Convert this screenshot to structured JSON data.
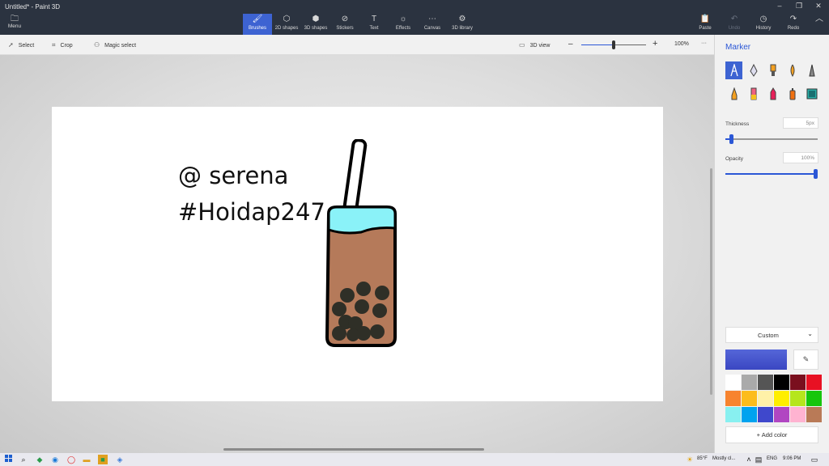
{
  "window": {
    "title": "Untitled* - Paint 3D",
    "controls": {
      "minimize": "–",
      "restore": "❐",
      "close": "✕"
    }
  },
  "ribbon": {
    "menu": {
      "label": "Menu",
      "icon": "folder-icon"
    },
    "tabs": [
      {
        "label": "Brushes",
        "icon": "brush-icon",
        "active": true
      },
      {
        "label": "2D shapes",
        "icon": "2d-shapes-icon"
      },
      {
        "label": "3D shapes",
        "icon": "3d-shapes-icon"
      },
      {
        "label": "Stickers",
        "icon": "sticker-icon"
      },
      {
        "label": "Text",
        "icon": "text-icon"
      },
      {
        "label": "Effects",
        "icon": "effects-icon"
      },
      {
        "label": "Canvas",
        "icon": "canvas-icon"
      },
      {
        "label": "3D library",
        "icon": "3d-library-icon"
      }
    ],
    "right_tools": [
      {
        "label": "Paste",
        "icon": "paste-icon",
        "enabled": true
      },
      {
        "label": "Undo",
        "icon": "undo-icon",
        "enabled": false
      },
      {
        "label": "History",
        "icon": "history-icon",
        "enabled": true
      },
      {
        "label": "Redo",
        "icon": "redo-icon",
        "enabled": true
      }
    ],
    "collapse_icon": "chevron-up-icon"
  },
  "toolbar": {
    "select": "Select",
    "crop": "Crop",
    "magic_select": "Magic select",
    "view_3d": "3D view",
    "zoom_out": "–",
    "zoom_in": "+",
    "zoom_level": "100%",
    "zoom_slider_fraction": 0.5,
    "more": "···"
  },
  "canvas": {
    "text_line1": "@ serena",
    "text_line2": "#Hoidap247",
    "drawing": "bubble-tea-drink"
  },
  "panel": {
    "title": "Marker",
    "brushes": [
      "marker",
      "calligraphy-pen",
      "oil-brush",
      "watercolor",
      "pixel-pen",
      "pencil",
      "eraser",
      "crayon",
      "spray-can",
      "fill"
    ],
    "selected_brush": "marker",
    "thickness": {
      "label": "Thickness",
      "value": "5px",
      "fraction": 0.05
    },
    "opacity": {
      "label": "Opacity",
      "value": "100%",
      "fraction": 1.0
    },
    "color_mode": "Custom",
    "current_color": "#3a47c2",
    "palette": [
      "#ffffff",
      "#aaaaaa",
      "#555555",
      "#000000",
      "#7a0f1e",
      "#e81123",
      "#f7832e",
      "#fcbc1c",
      "#fff1a8",
      "#ffee00",
      "#b5e61d",
      "#16c60c",
      "#88f0f0",
      "#00a3ef",
      "#3f48cc",
      "#b146c2",
      "#ffb3d1",
      "#b97a57"
    ],
    "add_color": "Add color"
  },
  "taskbar": {
    "weather": "85°F",
    "weather_desc": "Mostly cl...",
    "language": "ENG",
    "time": "9:06 PM"
  }
}
